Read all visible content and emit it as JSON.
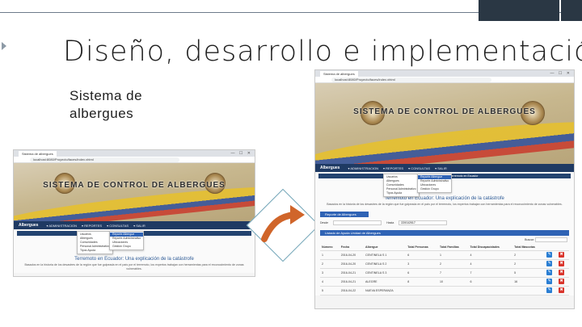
{
  "slide": {
    "title": "Diseño, desarrollo e implementación",
    "subtitle": "Sistema de albergues"
  },
  "shared": {
    "browser_tab": "Sistema de albergues",
    "url": "localhost:8080/Proyecto/faces/index.xhtml",
    "window_controls": "— ☐ ✕",
    "banner_title": "SISTEMA DE CONTROL DE ALBERGUES",
    "nav": {
      "brand": "Albergues",
      "items": [
        "▾ ADMINISTRACION",
        "▾ REPORTES",
        "▾ CONSULTAS",
        "▾ SALIR"
      ]
    },
    "dropdown_left": [
      "Usuarios",
      "Albergues",
      "Comunidades",
      "Personal Administrativo",
      "Tipos Ayuda"
    ],
    "dropdown_right": [
      "Reporte Albergue",
      "Reporte Administrativo",
      "Ubicaciones",
      "",
      "Gestión Grupo"
    ],
    "info_bar": "» Terremoto en Ecuador",
    "headline": "Terremoto en Ecuador: Una explicación de la catástrofe",
    "paragraph": "Basados en la historia de los desastres de la región que fue golpeada en el país por el terremoto, los expertos trabajan con herramientas para el reconocimiento de zonas vulnerables."
  },
  "report": {
    "panel_title": "Reporte de Albergues",
    "from_label": "Desde",
    "from_value": "",
    "to_label": "Hasta",
    "to_value": "22/01/2017",
    "list_title": "Listado de Ayuda Unidad de Albergues",
    "search_label": "Buscar:",
    "columns": [
      "Número",
      "Fecha",
      "Albergue",
      "Total Personas",
      "Total Familias",
      "Total Discapacidades",
      "Total Mascotas",
      "",
      ""
    ],
    "rows": [
      [
        "1",
        "2016-04-20",
        "CENTINELA S 1",
        "6",
        "1",
        "4",
        "2"
      ],
      [
        "2",
        "2016-04-20",
        "CENTINELA S 2",
        "3",
        "2",
        "4",
        "2"
      ],
      [
        "3",
        "2016-04-21",
        "CENTINELA S 3",
        "6",
        "7",
        "7",
        "5"
      ],
      [
        "4",
        "2016-04-21",
        "ALEGRE",
        "8",
        "10",
        "6",
        "16"
      ],
      [
        "5",
        "2016-04-22",
        "NUEVA ESPERANZA",
        "",
        "",
        "",
        ""
      ]
    ],
    "edit_glyph": "✎",
    "delete_glyph": "✖"
  },
  "icons": {
    "arrow": "curved-arrow-icon",
    "seal_left": "university-seal-icon",
    "seal_right": "army-seal-icon"
  },
  "colors": {
    "navbar": "#1f3a63",
    "accent": "#2f63b5",
    "arrow": "#d0652a",
    "edit": "#2a7ed3",
    "delete": "#d9342b"
  }
}
